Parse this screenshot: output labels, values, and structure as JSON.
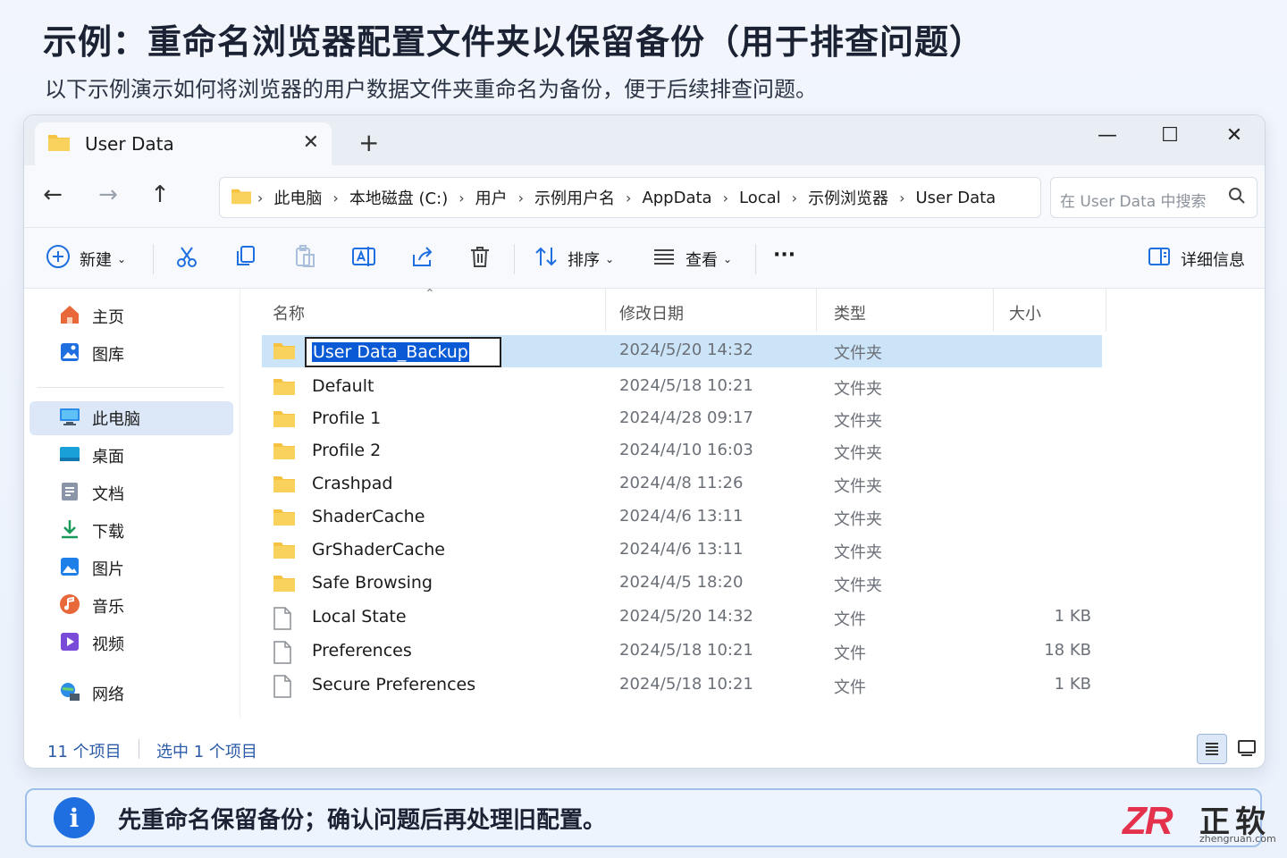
{
  "page": {
    "title": "示例：重命名浏览器配置文件夹以保留备份（用于排查问题）",
    "subtitle": "以下示例演示如何将浏览器的用户数据文件夹重命名为备份，便于后续排查问题。"
  },
  "window": {
    "tab_label": "User Data",
    "tab_close": "✕",
    "new_tab": "+",
    "controls": {
      "minimize": "—",
      "maximize": "☐",
      "close": "✕"
    }
  },
  "nav": {
    "back": "←",
    "forward": "→",
    "up": "↑"
  },
  "breadcrumb": [
    "此电脑",
    "本地磁盘 (C:)",
    "用户",
    "示例用户名",
    "AppData",
    "Local",
    "示例浏览器",
    "User Data"
  ],
  "search": {
    "placeholder": "在 User Data 中搜索"
  },
  "toolbar": {
    "new_label": "新建",
    "sort_label": "排序",
    "view_label": "查看",
    "more": "···",
    "details_label": "详细信息"
  },
  "sidebar": {
    "items": [
      {
        "label": "主页",
        "icon": "home-icon"
      },
      {
        "label": "图库",
        "icon": "gallery-icon"
      },
      {
        "label": "此电脑",
        "icon": "computer-icon",
        "active": true
      },
      {
        "label": "桌面",
        "icon": "desktop-icon"
      },
      {
        "label": "文档",
        "icon": "documents-icon"
      },
      {
        "label": "下载",
        "icon": "download-icon"
      },
      {
        "label": "图片",
        "icon": "pictures-icon"
      },
      {
        "label": "音乐",
        "icon": "music-icon"
      },
      {
        "label": "视频",
        "icon": "video-icon"
      },
      {
        "label": "网络",
        "icon": "network-icon"
      }
    ]
  },
  "columns": {
    "name": "名称",
    "date": "修改日期",
    "type": "类型",
    "size": "大小"
  },
  "files": [
    {
      "name": "User Data_Backup",
      "date": "2024/5/20 14:32",
      "type": "文件夹",
      "size": "",
      "kind": "folder",
      "selected": true,
      "renaming": true
    },
    {
      "name": "Default",
      "date": "2024/5/18 10:21",
      "type": "文件夹",
      "size": "",
      "kind": "folder"
    },
    {
      "name": "Profile 1",
      "date": "2024/4/28 09:17",
      "type": "文件夹",
      "size": "",
      "kind": "folder"
    },
    {
      "name": "Profile 2",
      "date": "2024/4/10 16:03",
      "type": "文件夹",
      "size": "",
      "kind": "folder"
    },
    {
      "name": "Crashpad",
      "date": "2024/4/8 11:26",
      "type": "文件夹",
      "size": "",
      "kind": "folder"
    },
    {
      "name": "ShaderCache",
      "date": "2024/4/6 13:11",
      "type": "文件夹",
      "size": "",
      "kind": "folder"
    },
    {
      "name": "GrShaderCache",
      "date": "2024/4/6 13:11",
      "type": "文件夹",
      "size": "",
      "kind": "folder"
    },
    {
      "name": "Safe Browsing",
      "date": "2024/4/5 18:20",
      "type": "文件夹",
      "size": "",
      "kind": "folder"
    },
    {
      "name": "Local State",
      "date": "2024/5/20 14:32",
      "type": "文件",
      "size": "1 KB",
      "kind": "file"
    },
    {
      "name": "Preferences",
      "date": "2024/5/18 10:21",
      "type": "文件",
      "size": "18 KB",
      "kind": "file"
    },
    {
      "name": "Secure Preferences",
      "date": "2024/5/18 10:21",
      "type": "文件",
      "size": "1 KB",
      "kind": "file"
    }
  ],
  "status": {
    "count": "11 个项目",
    "selected": "选中 1 个项目"
  },
  "tip": {
    "icon": "i",
    "text": "先重命名保留备份；确认问题后再处理旧配置。"
  },
  "logo": {
    "mark": "ZR",
    "cn": "正软",
    "url": "zhengruan.com"
  },
  "colors": {
    "accent": "#1f6fe0",
    "selection": "#cce4f7",
    "folder": "#f5c242",
    "logo_red": "#e4324d"
  }
}
